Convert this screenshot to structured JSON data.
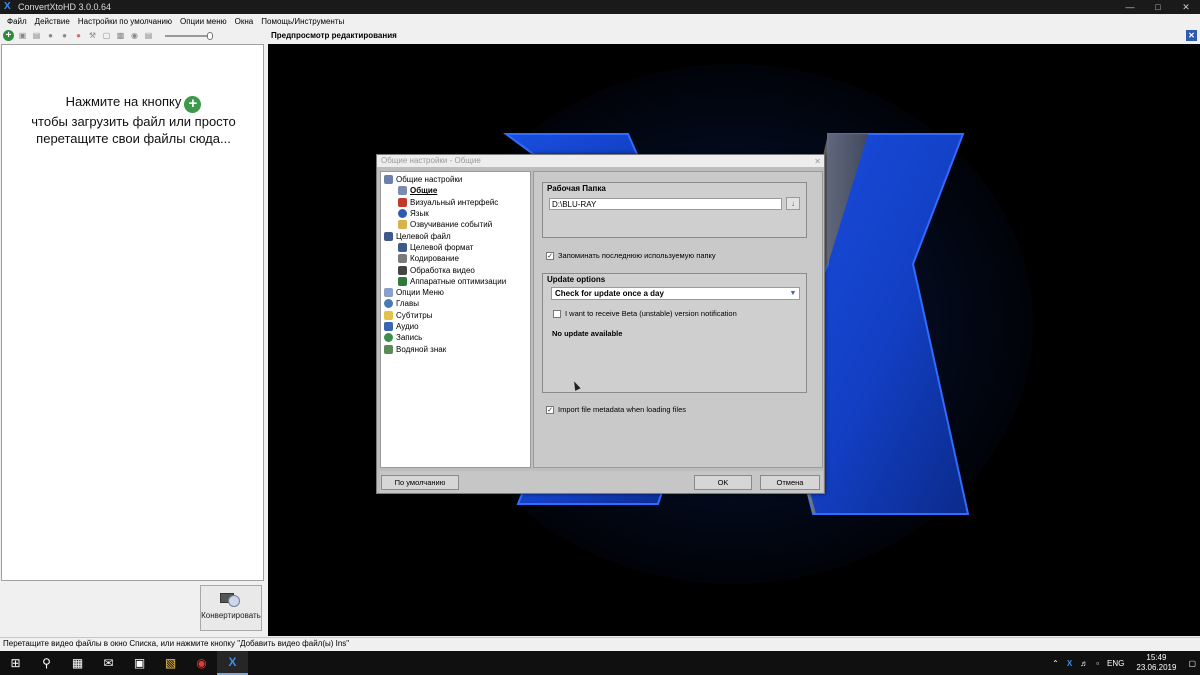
{
  "window": {
    "title": "ConvertXtoHD 3.0.0.64"
  },
  "menu": [
    "Файл",
    "Действие",
    "Настройки по умолчанию",
    "Опции меню",
    "Окна",
    "Помощь/Инструменты"
  ],
  "left_panel": {
    "hint_line1": "Нажмите на кнопку",
    "hint_line2": "чтобы загрузить файл или просто",
    "hint_line3": "перетащите свои файлы сюда...",
    "convert_label": "Конвертировать"
  },
  "preview": {
    "header": "Предпросмотр редактирования"
  },
  "dialog": {
    "title": "Общие настройки - Общие",
    "tree": [
      {
        "label": "Общие настройки",
        "level": 0,
        "icon_color": "#6b7fa8"
      },
      {
        "label": "Общие",
        "level": 1,
        "selected": true,
        "icon_color": "#7a8cb0"
      },
      {
        "label": "Визуальный интерфейс",
        "level": 1,
        "icon_color": "#c0392b"
      },
      {
        "label": "Язык",
        "level": 1,
        "icon_color": "#2a5db0"
      },
      {
        "label": "Озвучивание событий",
        "level": 1,
        "icon_color": "#d8b24a"
      },
      {
        "label": "Целевой файл",
        "level": 0,
        "icon_color": "#3d5a8a"
      },
      {
        "label": "Целевой формат",
        "level": 1,
        "icon_color": "#3d5a8a"
      },
      {
        "label": "Кодирование",
        "level": 1,
        "icon_color": "#7a7a7a"
      },
      {
        "label": "Обработка видео",
        "level": 1,
        "icon_color": "#444444"
      },
      {
        "label": "Аппаратные оптимизации",
        "level": 1,
        "icon_color": "#2f7a3a"
      },
      {
        "label": "Опции Меню",
        "level": 0,
        "icon_color": "#8aa0c8"
      },
      {
        "label": "Главы",
        "level": 0,
        "icon_color": "#4a78b8"
      },
      {
        "label": "Субтитры",
        "level": 0,
        "icon_color": "#e2c24a"
      },
      {
        "label": "Аудио",
        "level": 0,
        "icon_color": "#3a66b0"
      },
      {
        "label": "Запись",
        "level": 0,
        "icon_color": "#3c8f4a"
      },
      {
        "label": "Водяной знак",
        "level": 0,
        "icon_color": "#5a8a5a"
      }
    ],
    "work_folder": {
      "title": "Рабочая Папка",
      "path": "D:\\BLU-RAY"
    },
    "remember_folder": {
      "label": "Запоминать последнюю используемую папку",
      "checked": true
    },
    "update": {
      "title": "Update options",
      "selected": "Check for update once a day",
      "beta_label": "I want to receive Beta (unstable) version notification",
      "beta_checked": false,
      "status": "No update available"
    },
    "import_metadata": {
      "label": "Import file metadata when loading files",
      "checked": true
    },
    "buttons": {
      "default": "По умолчанию",
      "ok": "OK",
      "cancel": "Отмена"
    }
  },
  "statusbar": {
    "text": "Перетащите видео файлы в окно Списка, или нажмите кнопку \"Добавить видео файл(ы) Ins\""
  },
  "taskbar": {
    "lang": "ENG",
    "time": "15:49",
    "date": "23.06.2019"
  },
  "colors": {
    "accent_blue": "#1e56d6",
    "preview_bg": "#000000",
    "dialog_bg": "#bdbdbd"
  }
}
